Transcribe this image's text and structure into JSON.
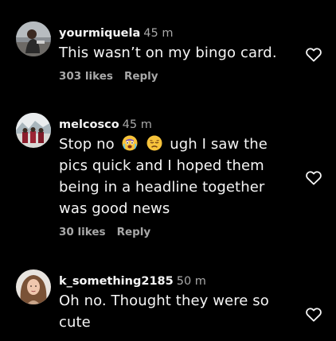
{
  "colors": {
    "background": "#000000",
    "primary_text": "#f5f5f5",
    "secondary_text": "#a8a8a8"
  },
  "comments": [
    {
      "username": "yourmiquela",
      "time": "45 m",
      "text": "This wasn’t on my bingo card.",
      "likes": "303 likes",
      "reply": "Reply",
      "like_icon": "heart-outline-icon"
    },
    {
      "username": "melcosco",
      "time": "45 m",
      "text_parts": [
        "Stop no",
        "ugh I saw the",
        "pics quick and I hoped them",
        "being in a headline together",
        "was good news"
      ],
      "emojis": [
        "loudly-crying-face-emoji",
        "disappointed-face-emoji"
      ],
      "likes": "30 likes",
      "reply": "Reply",
      "like_icon": "heart-outline-icon"
    },
    {
      "username": "k_something2185",
      "time": "50 m",
      "text_lines": [
        "Oh no. Thought they were so",
        "cute"
      ],
      "like_icon": "heart-outline-icon"
    }
  ]
}
